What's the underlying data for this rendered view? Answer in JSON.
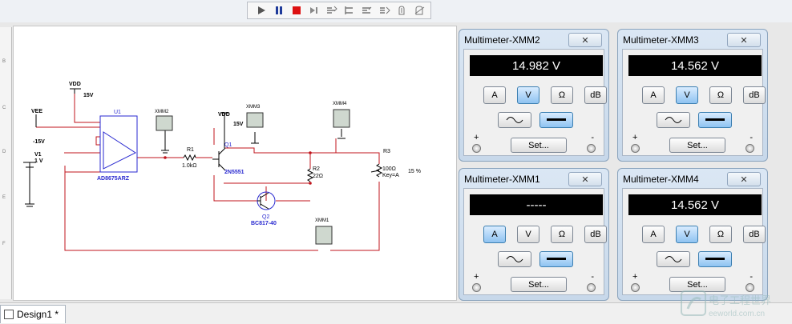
{
  "toolbar": {
    "buttons": [
      "run-icon",
      "pause-icon",
      "stop-icon",
      "step-icon",
      "step-into-icon",
      "step-over-icon",
      "step-out-icon",
      "run-to-cursor-icon",
      "toggle-breakpoint-icon",
      "remove-breakpoints-icon"
    ]
  },
  "ruler": {
    "labels": [
      "B",
      "C",
      "D",
      "E",
      "F"
    ]
  },
  "schematic": {
    "vdd1": "VDD",
    "vdd1_val": "15V",
    "vee": "VEE",
    "vee_val": "-15V",
    "v1": "V1",
    "v1_val": "1 V",
    "u1": "U1",
    "u1_part": "AD8675ARZ",
    "xmm2": "XMM2",
    "xmm3": "XMM3",
    "xmm4": "XMM4",
    "xmm1": "XMM1",
    "r1": "R1",
    "r1_val": "1.0kΩ",
    "q1": "Q1",
    "q1_part": "2N5551",
    "vdd2": "VDD",
    "vdd2_val": "15V",
    "r2": "R2",
    "r2_val": "22Ω",
    "q2": "Q2",
    "q2_part": "BC817-40",
    "r3": "R3",
    "r3_val": "100Ω",
    "r3_key": "Key=A",
    "r3_pct": "15 %"
  },
  "meters": [
    {
      "title": "Multimeter-XMM2",
      "display": "14.982 V",
      "active": "V"
    },
    {
      "title": "Multimeter-XMM3",
      "display": "14.562 V",
      "active": "V"
    },
    {
      "title": "Multimeter-XMM1",
      "display": "-----",
      "active": "A"
    },
    {
      "title": "Multimeter-XMM4",
      "display": "14.562 V",
      "active": "V"
    }
  ],
  "meter_ui": {
    "modes": [
      "A",
      "V",
      "Ω",
      "dB"
    ],
    "set_label": "Set...",
    "plus": "+",
    "minus": "-"
  },
  "tab": {
    "label": "Design1 *"
  },
  "watermark": {
    "text1": "电子工程世界",
    "text2": "eeworld.com.cn"
  }
}
